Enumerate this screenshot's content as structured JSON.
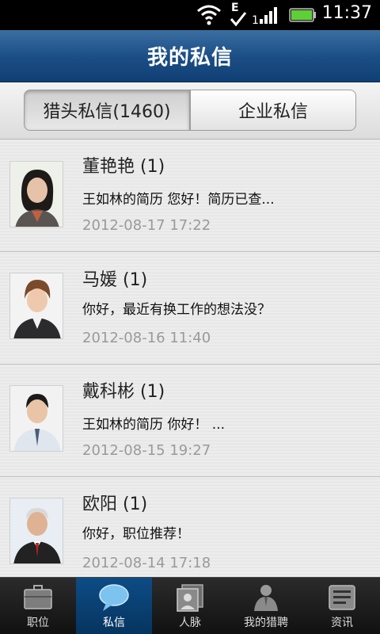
{
  "status": {
    "time": "11:37",
    "network": "E"
  },
  "header": {
    "title": "我的私信"
  },
  "segments": [
    {
      "label": "猎头私信(1460)",
      "selected": true
    },
    {
      "label": "企业私信",
      "selected": false
    }
  ],
  "messages": [
    {
      "name": "董艳艳 (1)",
      "text": "王如林的简历 您好！简历已查...",
      "date": "2012-08-17 17:22"
    },
    {
      "name": "马媛 (1)",
      "text": "你好，最近有换工作的想法没？",
      "date": "2012-08-16 11:40"
    },
    {
      "name": "戴科彬 (1)",
      "text": "王如林的简历 你好！  ...",
      "date": "2012-08-15 19:27"
    },
    {
      "name": "欧阳 (1)",
      "text": "你好，职位推荐！",
      "date": "2012-08-14 17:18"
    }
  ],
  "nav": [
    {
      "label": "职位",
      "icon": "briefcase-icon",
      "active": false
    },
    {
      "label": "私信",
      "icon": "chat-bubble-icon",
      "active": true
    },
    {
      "label": "人脉",
      "icon": "contacts-icon",
      "active": false
    },
    {
      "label": "我的猎聘",
      "icon": "profile-icon",
      "active": false
    },
    {
      "label": "资讯",
      "icon": "news-icon",
      "active": false
    }
  ]
}
